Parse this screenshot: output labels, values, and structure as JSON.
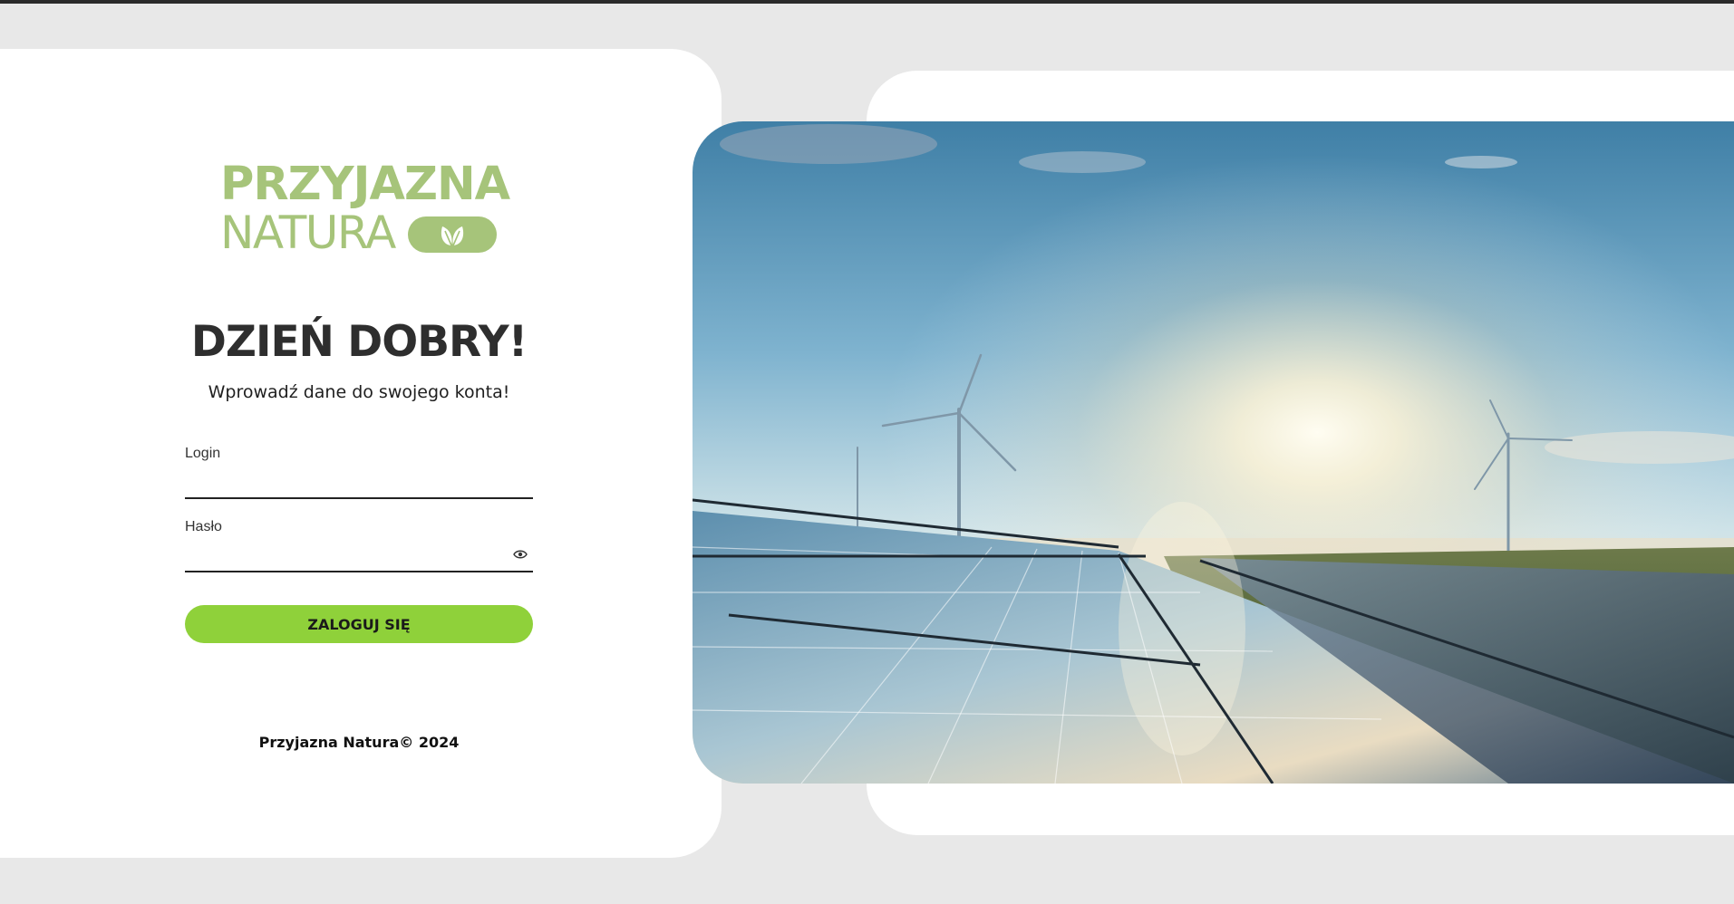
{
  "brand": {
    "logo_line1": "PRZYJAZNA",
    "logo_line2": "NATURA",
    "logo_icon": "leaf-icon",
    "color": "#a6c47a"
  },
  "login_form": {
    "greeting": "DZIEŃ DOBRY!",
    "subtitle": "Wprowadź dane do swojego konta!",
    "login_label": "Login",
    "login_value": "",
    "password_label": "Hasło",
    "password_value": "",
    "password_toggle_icon": "eye-icon",
    "submit_label": "ZALOGUJ SIĘ",
    "submit_color": "#8fd13a"
  },
  "footer": {
    "copyright": "Przyjazna Natura© 2024"
  },
  "hero_image": {
    "subject": "solar-panels-and-wind-turbines-photo"
  }
}
